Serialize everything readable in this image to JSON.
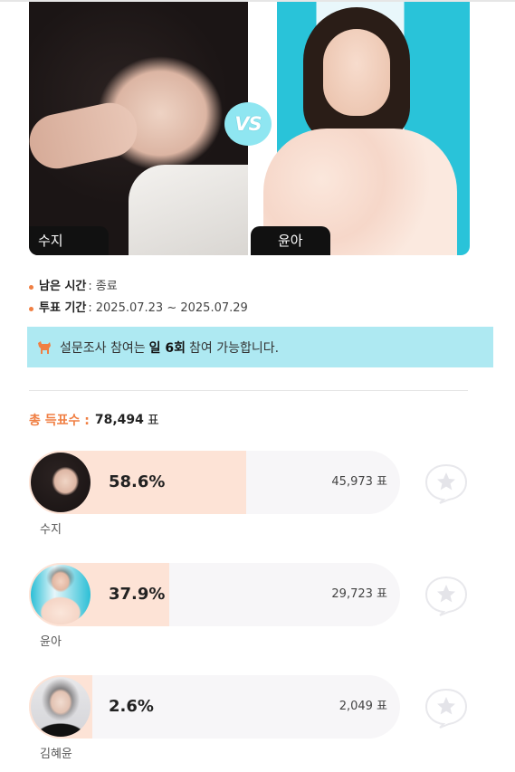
{
  "hero": {
    "vs_label": "VS",
    "left_name": "수지",
    "right_name": "윤아"
  },
  "info": {
    "remaining_label": "남은 시간",
    "remaining_value": "종료",
    "period_label": "투표 기간",
    "period_value": "2025.07.23 ~ 2025.07.29"
  },
  "notice": {
    "prefix": "설문조사 참여는",
    "highlight": "일 6회",
    "suffix": "참여 가능합니다."
  },
  "total": {
    "label": "총 득표수 :",
    "value": "78,494",
    "unit": "표"
  },
  "candidates": [
    {
      "name": "수지",
      "percent_text": "58.6%",
      "percent": 58.6,
      "votes": "45,973 표"
    },
    {
      "name": "윤아",
      "percent_text": "37.9%",
      "percent": 37.9,
      "votes": "29,723 표"
    },
    {
      "name": "김혜윤",
      "percent_text": "2.6%",
      "percent": 2.6,
      "votes": "2,049 표"
    }
  ],
  "colors": {
    "accent": "#f07f43",
    "notice_bg": "#aee9f2",
    "bar_fill": "#fde3d6",
    "bar_bg": "#f7f6f8",
    "vs_badge": "#8fe6f1"
  },
  "icons": {
    "notice": "dog-icon",
    "vote": "star-speech-bubble-icon"
  }
}
